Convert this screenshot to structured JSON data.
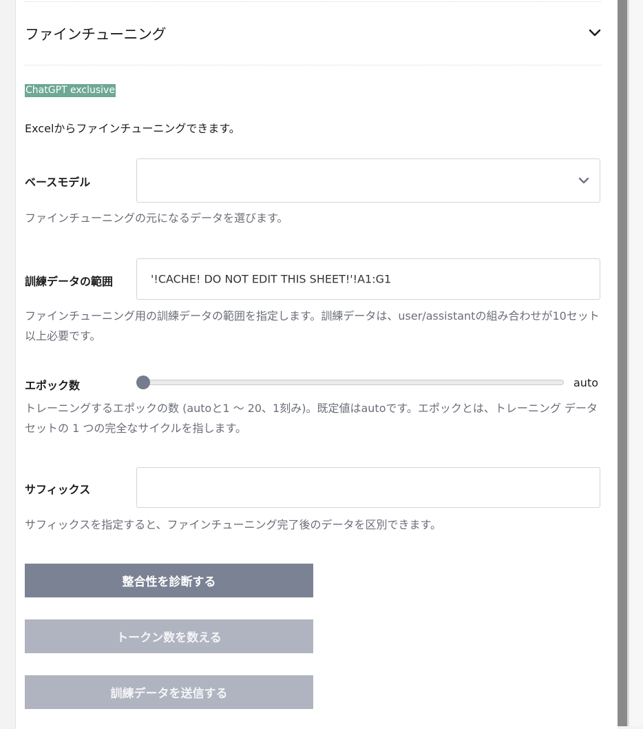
{
  "section": {
    "title": "ファインチューニング",
    "collapse_icon": "chevron-down-icon"
  },
  "badge": "ChatGPT exclusive",
  "intro": "Excelからファインチューニングできます。",
  "base_model": {
    "label": "ベースモデル",
    "value": "",
    "help": "ファインチューニングの元になるデータを選びます。"
  },
  "training_range": {
    "label": "訓練データの範囲",
    "value": "'!CACHE! DO NOT EDIT THIS SHEET!'!A1:G1",
    "help": "ファインチューニング用の訓練データの範囲を指定します。訓練データは、user/assistantの組み合わせが10セット以上必要です。"
  },
  "epochs": {
    "label": "エポック数",
    "value_text": "auto",
    "slider_fraction": 0,
    "help": "トレーニングするエポックの数 (autoと1 ～ 20、1刻み)。既定値はautoです。エポックとは、トレーニング データセットの 1 つの完全なサイクルを指します。"
  },
  "suffix": {
    "label": "サフィックス",
    "value": "",
    "help": "サフィックスを指定すると、ファインチューニング完了後のデータを区別できます。"
  },
  "buttons": {
    "diagnose": "整合性を診断する",
    "count_tokens": "トークン数を数える",
    "send_training": "訓練データを送信する"
  },
  "colors": {
    "badge_bg": "#6fa894",
    "primary_button": "#7a8294",
    "disabled_button": "#b0b4c0",
    "help_text": "#6b6e78"
  }
}
